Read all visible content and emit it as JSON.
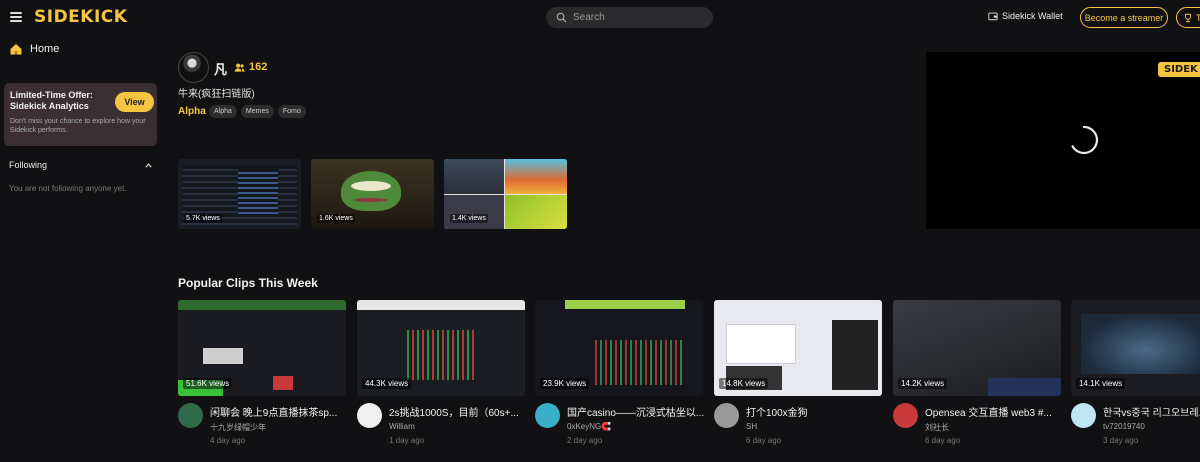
{
  "app": {
    "logo": "SIDEKICK"
  },
  "header": {
    "search_placeholder": "Search",
    "wallet_label": "Sidekick Wallet",
    "become_streamer_label": "Become a streamer",
    "trophy_text": "T"
  },
  "sidebar": {
    "home_label": "Home",
    "promo": {
      "title": "Limited-Time Offer: Sidekick Analytics",
      "subtitle": "Don't miss your chance to explore how your Sidekick performs.",
      "view_label": "View"
    },
    "following_label": "Following",
    "following_empty": "You are not following anyone yet."
  },
  "stream": {
    "name": "凡",
    "followers": "162",
    "title": "牛来(疯狂扫链版)",
    "category": "Alpha",
    "tags": [
      "Alpha",
      "Memes",
      "Fomo"
    ],
    "thumbnails": [
      {
        "views": "5.7K views"
      },
      {
        "views": "1.6K views"
      },
      {
        "views": "1.4K views"
      }
    ],
    "player_badge": "SIDEK"
  },
  "popular": {
    "title": "Popular Clips This Week",
    "clips": [
      {
        "views": "51.6K views",
        "title": "闲聊会 晚上9点直播抹茶sp...",
        "user": "十九岁绿帽少年",
        "age": "4 day ago",
        "avatar_color": "#2f6b4a"
      },
      {
        "views": "44.3K views",
        "title": "2s挑战1000S，目前（60s+...",
        "user": "William",
        "age": "1 day ago",
        "avatar_color": "#f0f0f0"
      },
      {
        "views": "23.9K views",
        "title": "国产casino——沉浸式枯坐以...",
        "user": "0xKeyNG🧲",
        "age": "2 day ago",
        "avatar_color": "#3ab0c8"
      },
      {
        "views": "14.8K views",
        "title": "打个100x金狗",
        "user": "SH",
        "age": "6 day ago",
        "avatar_color": "#9a9a9a"
      },
      {
        "views": "14.2K views",
        "title": "Opensea 交互直播 web3 #...",
        "user": "刘社长",
        "age": "6 day ago",
        "avatar_color": "#c83a3a"
      },
      {
        "views": "14.1K views",
        "title": "한국vs중국 리그오브레...",
        "user": "tv72019740",
        "age": "3 day ago",
        "avatar_color": "#bfe6f0"
      }
    ]
  },
  "colors": {
    "accent": "#f5c542",
    "background": "#111113",
    "promo_bg": "#3a3034"
  },
  "icons": [
    "menu-icon",
    "search-icon",
    "wallet-icon",
    "trophy-icon",
    "home-icon",
    "chevron-up-icon",
    "followers-icon",
    "loading-spinner-icon"
  ]
}
